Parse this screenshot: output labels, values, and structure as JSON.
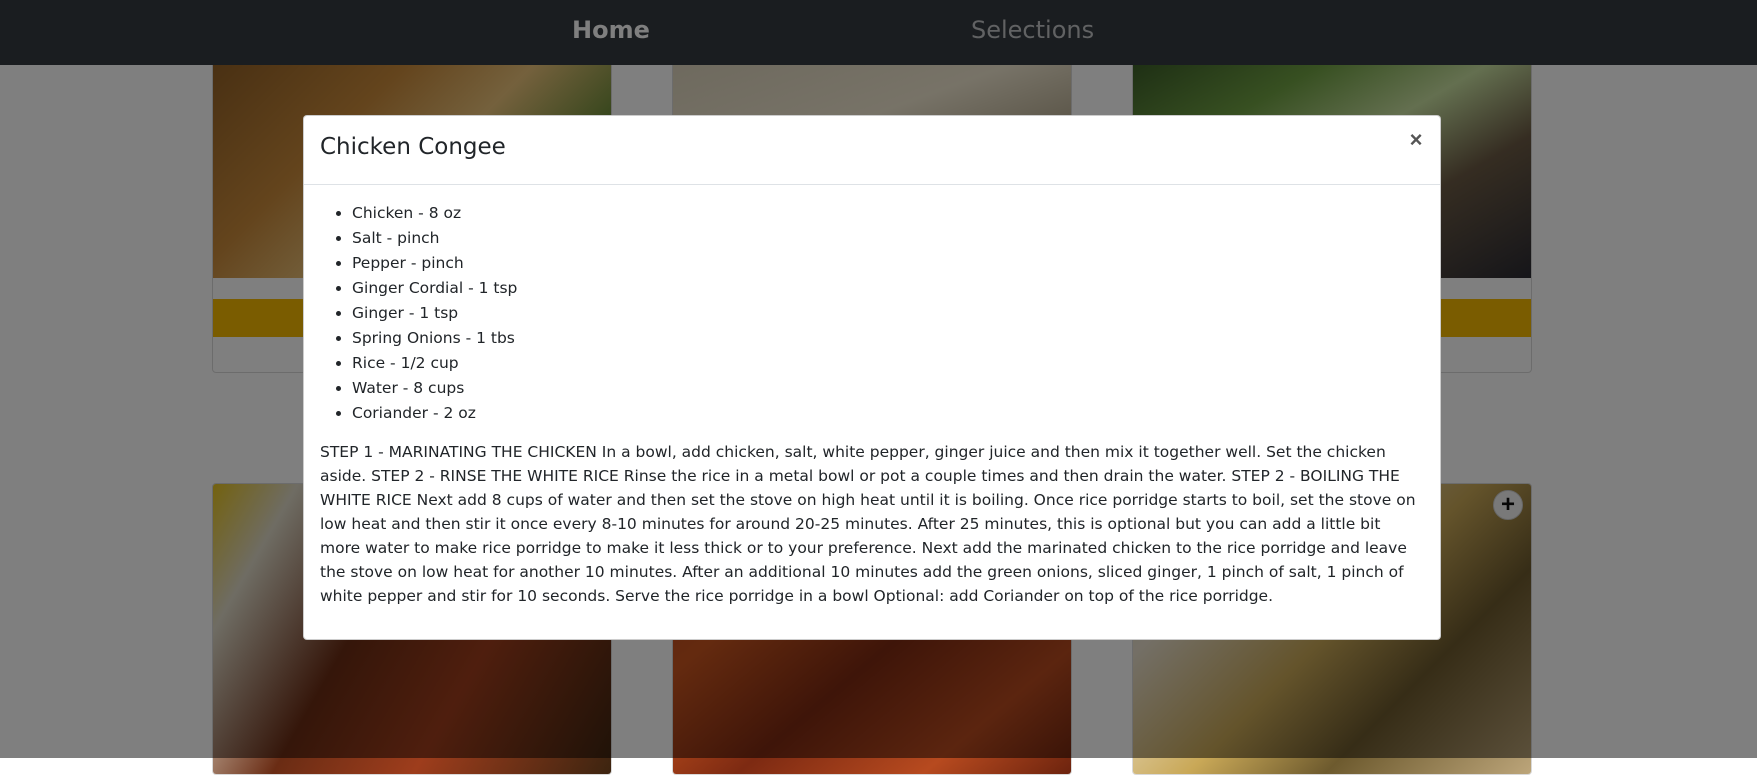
{
  "nav": {
    "home_label": "Home",
    "selections_label": "Selections"
  },
  "modal": {
    "title": "Chicken Congee",
    "close_label": "×",
    "ingredients": [
      "Chicken - 8 oz",
      "Salt - pinch",
      "Pepper - pinch",
      "Ginger Cordial - 1 tsp",
      "Ginger - 1 tsp",
      "Spring Onions - 1 tbs",
      "Rice - 1/2 cup",
      "Water - 8 cups",
      "Coriander - 2 oz"
    ],
    "instructions": "STEP 1 - MARINATING THE CHICKEN In a bowl, add chicken, salt, white pepper, ginger juice and then mix it together well. Set the chicken aside. STEP 2 - RINSE THE WHITE RICE Rinse the rice in a metal bowl or pot a couple times and then drain the water. STEP 2 - BOILING THE WHITE RICE Next add 8 cups of water and then set the stove on high heat until it is boiling. Once rice porridge starts to boil, set the stove on low heat and then stir it once every 8-10 minutes for around 20-25 minutes. After 25 minutes, this is optional but you can add a little bit more water to make rice porridge to make it less thick or to your preference. Next add the marinated chicken to the rice porridge and leave the stove on low heat for another 10 minutes. After an additional 10 minutes add the green onions, sliced ginger, 1 pinch of salt, 1 pinch of white pepper and stir for 10 seconds. Serve the rice porridge in a bowl Optional: add Coriander on top of the rice porridge."
  },
  "cards": {
    "add_label": "+"
  },
  "colors": {
    "navbar": "#343a40",
    "card_button": "#f5b900",
    "backdrop": "rgba(0,0,0,0.5)"
  }
}
